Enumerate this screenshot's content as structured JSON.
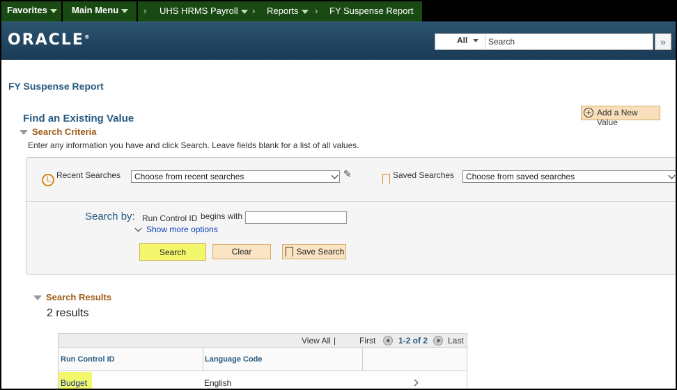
{
  "nav": {
    "favorites": "Favorites",
    "main_menu": "Main Menu",
    "crumbs": [
      "UHS HRMS Payroll",
      "Reports",
      "FY Suspense Report"
    ]
  },
  "banner": {
    "logo": "ORACLE",
    "search_scope": "All",
    "search_placeholder": "Search",
    "go_icon": "double-chevron-right-icon"
  },
  "page": {
    "title": "FY Suspense Report",
    "find_title": "Find an Existing Value",
    "add_new": "Add a New Value"
  },
  "criteria": {
    "heading": "Search Criteria",
    "hint": "Enter any information you have and click Search. Leave fields blank for a list of all values.",
    "recent_label": "Recent Searches",
    "recent_value": "Choose from recent searches",
    "saved_label": "Saved Searches",
    "saved_value": "Choose from saved searches",
    "search_by": "Search by:",
    "field_label": "Run Control ID",
    "operator": "begins with",
    "field_value": "",
    "more_options": "Show more options",
    "buttons": {
      "search": "Search",
      "clear": "Clear",
      "save": "Save Search"
    }
  },
  "results": {
    "heading": "Search Results",
    "count": "2 results",
    "view_all": "View All",
    "first": "First",
    "range": "1-2 of 2",
    "last": "Last",
    "columns": [
      "Run Control ID",
      "Language Code"
    ],
    "rows": [
      {
        "id": "Budget",
        "lang": "English"
      }
    ]
  },
  "colors": {
    "nav_green": "#1a4a13",
    "banner_blue": "#2c5370",
    "title_blue": "#265a82",
    "section_brown": "#9e5a16",
    "highlight_yellow": "#f3f76c",
    "button_peach": "#fbe4c4"
  }
}
